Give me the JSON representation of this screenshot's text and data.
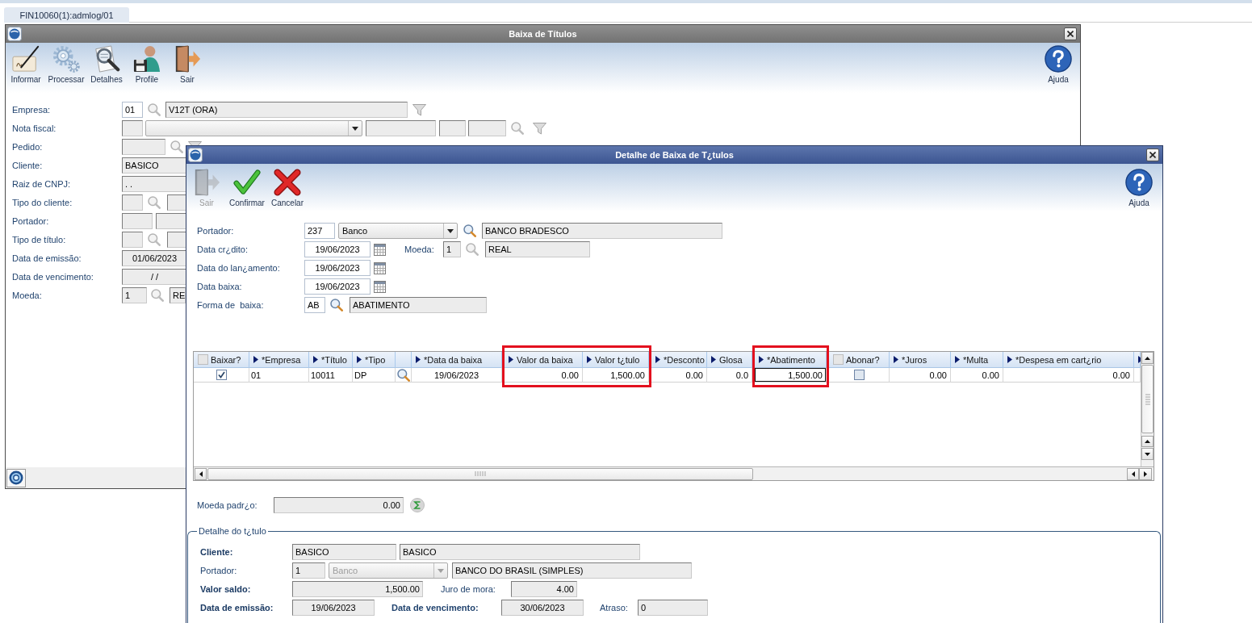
{
  "app_tabs": [
    {
      "label": "FIN10060(1):admlog/01",
      "selected": true
    }
  ],
  "main_window": {
    "title": "Baixa de Títulos",
    "toolbar": [
      {
        "label": "Informar",
        "kind": "edit",
        "disabled": false
      },
      {
        "label": "Processar",
        "kind": "process",
        "disabled": false
      },
      {
        "label": "Detalhes",
        "kind": "details",
        "disabled": false
      },
      {
        "label": "Profile",
        "kind": "profile",
        "disabled": false
      },
      {
        "label": "Sair",
        "kind": "exit",
        "disabled": false
      }
    ],
    "help": {
      "label": "Ajuda"
    },
    "form": [
      {
        "label": "Empresa:",
        "controls": [
          {
            "kind": "text",
            "value": "01",
            "readonly": false
          },
          {
            "kind": "lookup",
            "disabled": true
          },
          {
            "kind": "text",
            "value": "V12T (ORA)",
            "readonly": true
          },
          {
            "kind": "filter",
            "disabled": true
          }
        ]
      },
      {
        "label": "Nota fiscal:",
        "controls": [
          {
            "kind": "text",
            "readonly": true
          },
          {
            "kind": "dropdown",
            "disabled": false
          },
          {
            "kind": "text",
            "readonly": true
          },
          {
            "kind": "text",
            "readonly": true
          },
          {
            "kind": "text",
            "readonly": true
          },
          {
            "kind": "lookup",
            "disabled": true
          },
          {
            "kind": "filter",
            "disabled": true
          }
        ]
      },
      {
        "label": "Pedido:",
        "controls": [
          {
            "kind": "text",
            "readonly": true
          },
          {
            "kind": "lookup",
            "disabled": true
          },
          {
            "kind": "filter",
            "disabled": true
          }
        ]
      },
      {
        "label": "Cliente:",
        "controls": [
          {
            "kind": "text",
            "value": "BASICO",
            "readonly": true
          }
        ]
      },
      {
        "label": "Raiz de CNPJ:",
        "controls": [
          {
            "kind": "text",
            "value": ". .",
            "readonly": true
          }
        ]
      },
      {
        "label": "Tipo do cliente:",
        "controls": [
          {
            "kind": "text",
            "readonly": true
          },
          {
            "kind": "lookup",
            "disabled": true
          },
          {
            "kind": "text",
            "readonly": true
          }
        ]
      },
      {
        "label": "Portador:",
        "controls": [
          {
            "kind": "text",
            "readonly": true
          },
          {
            "kind": "text",
            "readonly": true
          }
        ]
      },
      {
        "label": "Tipo de título:",
        "controls": [
          {
            "kind": "text",
            "readonly": true
          },
          {
            "kind": "lookup",
            "disabled": true
          },
          {
            "kind": "text",
            "readonly": true
          }
        ]
      },
      {
        "label": "Data de emissão:",
        "controls": [
          {
            "kind": "date",
            "value": "01/06/2023",
            "readonly": true
          }
        ]
      },
      {
        "label": "Data de vencimento:",
        "controls": [
          {
            "kind": "date",
            "value": "/ /",
            "readonly": true
          }
        ]
      },
      {
        "label": "Moeda:",
        "controls": [
          {
            "kind": "text",
            "value": "1",
            "readonly": true
          },
          {
            "kind": "lookup",
            "disabled": true
          },
          {
            "kind": "text",
            "value": "RE",
            "readonly": true
          }
        ]
      }
    ]
  },
  "detail_window": {
    "title": "Detalhe de Baixa de T¿tulos",
    "toolbar": [
      {
        "label": "Sair",
        "kind": "exit",
        "disabled": true
      },
      {
        "label": "Confirmar",
        "kind": "confirm",
        "disabled": false
      },
      {
        "label": "Cancelar",
        "kind": "cancel",
        "disabled": false
      }
    ],
    "help": {
      "label": "Ajuda"
    },
    "form": [
      {
        "label": "Portador:",
        "controls": [
          {
            "kind": "text",
            "value": "237",
            "readonly": false
          },
          {
            "kind": "dropdown",
            "value": "Banco",
            "disabled": false
          },
          {
            "kind": "lookup",
            "disabled": false
          },
          {
            "kind": "text",
            "value": "BANCO BRADESCO",
            "readonly": true
          }
        ]
      },
      {
        "label": "Data cr¿dito:",
        "controls": [
          {
            "kind": "date",
            "value": "19/06/2023",
            "readonly": false
          },
          {
            "kind": "calendar"
          },
          {
            "kind": "label",
            "text": "Moeda:",
            "bold": false
          },
          {
            "kind": "text",
            "value": "1",
            "readonly": true
          },
          {
            "kind": "lookup",
            "disabled": true
          },
          {
            "kind": "text",
            "value": "REAL",
            "readonly": true
          }
        ]
      },
      {
        "label": "Data do lan¿amento:",
        "controls": [
          {
            "kind": "date",
            "value": "19/06/2023",
            "readonly": false
          },
          {
            "kind": "calendar"
          }
        ]
      },
      {
        "label": "Data baixa:",
        "controls": [
          {
            "kind": "date",
            "value": "19/06/2023",
            "readonly": false
          },
          {
            "kind": "calendar"
          }
        ]
      },
      {
        "label": "Forma de  baixa:",
        "controls": [
          {
            "kind": "text",
            "value": "AB",
            "readonly": false
          },
          {
            "kind": "lookup",
            "disabled": false
          },
          {
            "kind": "text",
            "value": "ABATIMENTO",
            "readonly": true
          }
        ]
      }
    ],
    "grid": {
      "columns": [
        {
          "label": "Baixar?",
          "kind": "check",
          "header_checked": false,
          "highlighted": false
        },
        {
          "label": "*Empresa",
          "kind": "sort",
          "highlighted": false
        },
        {
          "label": "*Título",
          "kind": "sort",
          "highlighted": false
        },
        {
          "label": "*Tipo",
          "kind": "sort",
          "highlighted": false
        },
        {
          "kind": "plain",
          "highlighted": false
        },
        {
          "label": "*Data da baixa",
          "kind": "sort",
          "highlighted": false
        },
        {
          "label": "Valor da baixa",
          "kind": "sort",
          "highlighted": true
        },
        {
          "label": "Valor t¿tulo",
          "kind": "sort",
          "highlighted": true
        },
        {
          "label": "*Desconto",
          "kind": "sort",
          "highlighted": false
        },
        {
          "label": "Glosa",
          "kind": "sort",
          "highlighted": false
        },
        {
          "label": "*Abatimento",
          "kind": "sort",
          "highlighted": true
        },
        {
          "label": "Abonar?",
          "kind": "check",
          "header_checked": false,
          "highlighted": false
        },
        {
          "label": "*Juros",
          "kind": "sort",
          "highlighted": false
        },
        {
          "label": "*Multa",
          "kind": "sort",
          "highlighted": false
        },
        {
          "label": "*Despesa em cart¿rio",
          "kind": "sort",
          "highlighted": false
        },
        {
          "kind": "sort",
          "highlighted": false
        }
      ],
      "rows": [
        {
          "cells": [
            {
              "kind": "check",
              "checked": true
            },
            {
              "kind": "text",
              "value": "01",
              "editing": false
            },
            {
              "kind": "text",
              "value": "10011",
              "editing": false
            },
            {
              "kind": "text",
              "value": "DP",
              "editing": false
            },
            {
              "kind": "lookup",
              "disabled": false
            },
            {
              "kind": "date",
              "value": "19/06/2023",
              "editing": false
            },
            {
              "kind": "number",
              "value": "0.00",
              "editing": false
            },
            {
              "kind": "number",
              "value": "1,500.00",
              "editing": false
            },
            {
              "kind": "number",
              "value": "0.00",
              "editing": false
            },
            {
              "kind": "number",
              "value": "0.0",
              "editing": false
            },
            {
              "kind": "number",
              "value": "1,500.00",
              "editing": true
            },
            {
              "kind": "check",
              "checked": false
            },
            {
              "kind": "number",
              "value": "0.00",
              "editing": false
            },
            {
              "kind": "number",
              "value": "0.00",
              "editing": false
            },
            {
              "kind": "number",
              "value": "0.00",
              "editing": false
            }
          ]
        }
      ]
    },
    "currency_total": {
      "label": "Moeda padr¿o:",
      "value": "0.00"
    },
    "detail_group": {
      "title": "Detalhe do t¿tulo",
      "rows": [
        {
          "label": "Cliente:",
          "bold": true,
          "controls": [
            {
              "kind": "text",
              "value": "BASICO",
              "readonly": true
            },
            {
              "kind": "text",
              "value": "BASICO",
              "readonly": true
            }
          ]
        },
        {
          "label": "Portador:",
          "bold": false,
          "controls": [
            {
              "kind": "text",
              "value": "1",
              "readonly": true
            },
            {
              "kind": "dropdown",
              "value": "Banco",
              "disabled": true
            },
            {
              "kind": "text",
              "value": "BANCO DO BRASIL (SIMPLES)",
              "readonly": true
            }
          ]
        },
        {
          "label": "Valor saldo:",
          "bold": true,
          "controls": [
            {
              "kind": "number",
              "value": "1,500.00",
              "readonly": true
            },
            {
              "kind": "label",
              "text": "Juro de mora:",
              "bold": false
            },
            {
              "kind": "number",
              "value": "4.00",
              "readonly": true
            }
          ]
        },
        {
          "label": "Data de emissão:",
          "bold": true,
          "controls": [
            {
              "kind": "date",
              "value": "19/06/2023",
              "readonly": true
            },
            {
              "kind": "label",
              "text": "Data de vencimento:",
              "bold": true
            },
            {
              "kind": "date",
              "value": "30/06/2023",
              "readonly": true
            },
            {
              "kind": "label",
              "text": "Atraso:",
              "bold": false
            },
            {
              "kind": "text",
              "value": "0",
              "readonly": true
            }
          ]
        }
      ]
    }
  }
}
